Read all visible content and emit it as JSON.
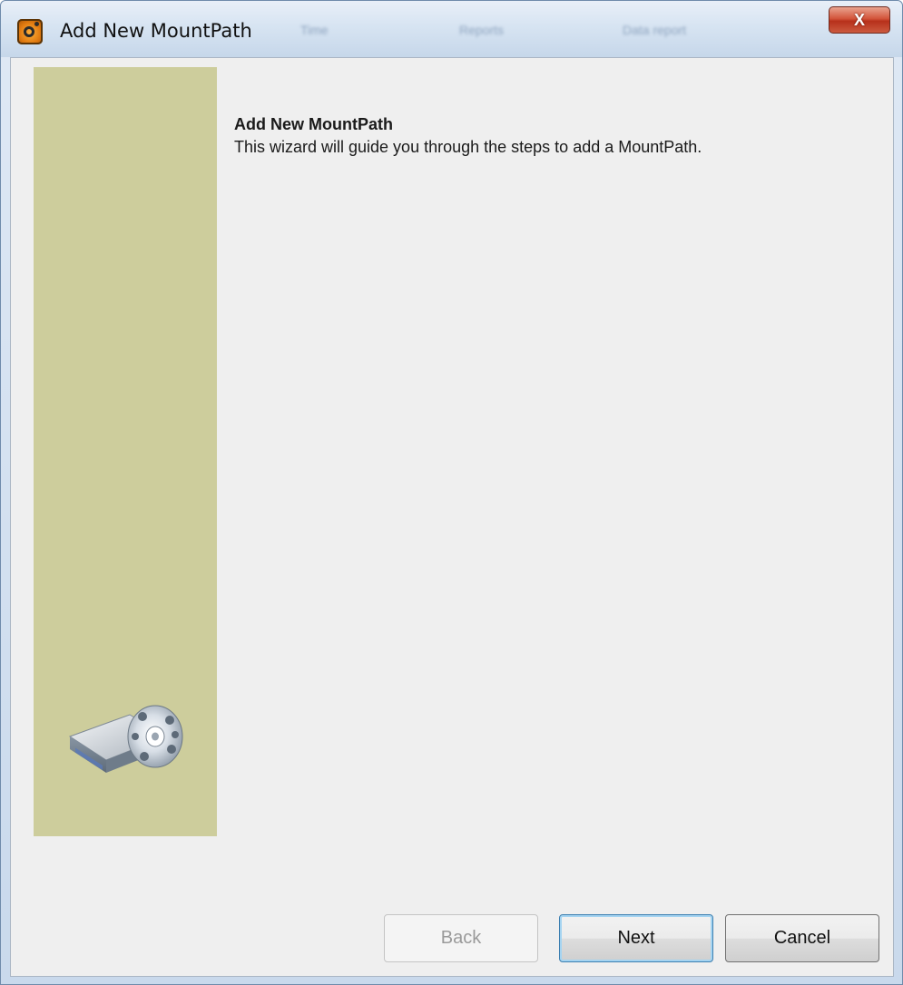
{
  "window": {
    "title": "Add New MountPath",
    "close_label": "X",
    "background_tabs": [
      "Time",
      "Reports",
      "Data report"
    ]
  },
  "wizard": {
    "heading": "Add New MountPath",
    "description": "This wizard will guide you through the steps to add a MountPath.",
    "side_panel_color": "#cdcd9c",
    "illustration_icon": "drive-disc-icon"
  },
  "buttons": {
    "back": "Back",
    "next": "Next",
    "cancel": "Cancel"
  }
}
